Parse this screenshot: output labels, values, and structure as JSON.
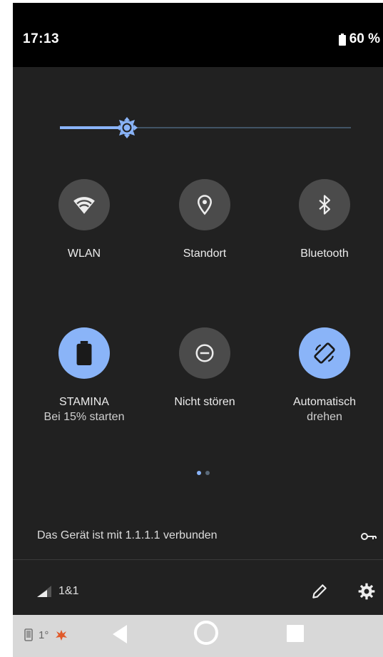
{
  "status_bar": {
    "time": "17:13",
    "battery": "60 %"
  },
  "brightness": {
    "level": 0.23
  },
  "tiles": [
    {
      "id": "wlan",
      "label": "WLAN",
      "sublabel": "",
      "active": false,
      "icon": "wifi-icon"
    },
    {
      "id": "standort",
      "label": "Standort",
      "sublabel": "",
      "active": false,
      "icon": "location-pin-icon"
    },
    {
      "id": "bluetooth",
      "label": "Bluetooth",
      "sublabel": "",
      "active": false,
      "icon": "bluetooth-icon"
    },
    {
      "id": "stamina",
      "label": "STAMINA",
      "sublabel": "Bei 15% starten",
      "active": true,
      "icon": "battery-icon"
    },
    {
      "id": "nicht-stoeren",
      "label": "Nicht stören",
      "sublabel": "",
      "active": false,
      "icon": "do-not-disturb-icon"
    },
    {
      "id": "auto-rotate",
      "label": "Automatisch",
      "sublabel": "drehen",
      "active": true,
      "icon": "auto-rotate-icon"
    }
  ],
  "pager": {
    "pages": 2,
    "current": 1
  },
  "vpn": {
    "text": "Das Gerät ist mit 1.1.1.1 verbunden",
    "icon": "vpn-key-icon"
  },
  "carrier": {
    "name": "1&1",
    "icon": "signal-icon"
  },
  "footer_icons": {
    "edit": "edit-pencil-icon",
    "settings": "gear-icon"
  },
  "nav": {
    "notif_text": "1°",
    "icons": [
      "phone-notification-icon",
      "app-notification-icon",
      "back-icon",
      "home-icon",
      "recents-icon"
    ]
  },
  "colors": {
    "panel_bg": "#212121",
    "accent": "#8ab4f8",
    "tile_off": "#4b4b4b",
    "status_bg": "#000000",
    "nav_bg": "#d8d8d8"
  }
}
